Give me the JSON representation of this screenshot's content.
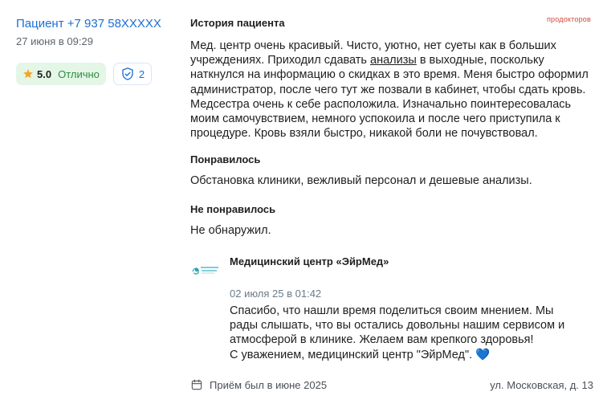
{
  "author": {
    "name": "Пациент +7 937 58XXXXX",
    "date": "27 июня в 09:29"
  },
  "rating": {
    "value": "5.0",
    "label": "Отлично",
    "verified_count": "2",
    "star_color": "#f5a623",
    "badge_bg": "#e4f6e6"
  },
  "brand": "продокторов",
  "story": {
    "title": "История пациента",
    "text_before_link": "Мед. центр очень красивый. Чисто, уютно, нет суеты как в больших учреждениях. Приходил сдавать ",
    "link": "анализы",
    "text_after_link": " в выходные, поскольку наткнулся на информацию о скидках в это время. Меня быстро оформил администратор, после чего тут же позвали в кабинет, чтобы сдать кровь. Медсестра очень к себе расположила. Изначально поинтересовалась моим самочувствием, немного успокоила и после чего приступила к процедуре. Кровь взяли быстро, никакой боли не почувствовал."
  },
  "liked": {
    "title": "Понравилось",
    "text": "Обстановка клиники, вежливый персонал и дешевые анализы."
  },
  "disliked": {
    "title": "Не понравилось",
    "text": "Не обнаружил."
  },
  "reply": {
    "org_name": "Медицинский центр «ЭйрМед»",
    "date": "02 июля 25 в 01:42",
    "lines": [
      "Спасибо, что нашли время поделиться своим мнением. Мы",
      "рады слышать, что вы остались довольны нашим сервисом и",
      "атмосферой в клинике. Желаем вам крепкого здоровья!"
    ],
    "last_line": "С уважением, медицинский центр \"ЭйрМед\".",
    "heart": "💙"
  },
  "footer": {
    "visit": "Приём был в июне 2025",
    "address": "ул. Московская, д. 13"
  },
  "colors": {
    "accent": "#1a6fd6",
    "rating_text": "#2f8b43",
    "brand": "#d04a3a",
    "heart": "#1f8ad1"
  },
  "icons": {
    "star": "star-icon",
    "verified": "shield-check-icon",
    "calendar": "calendar-icon",
    "clinic_logo": "clinic-logo"
  }
}
